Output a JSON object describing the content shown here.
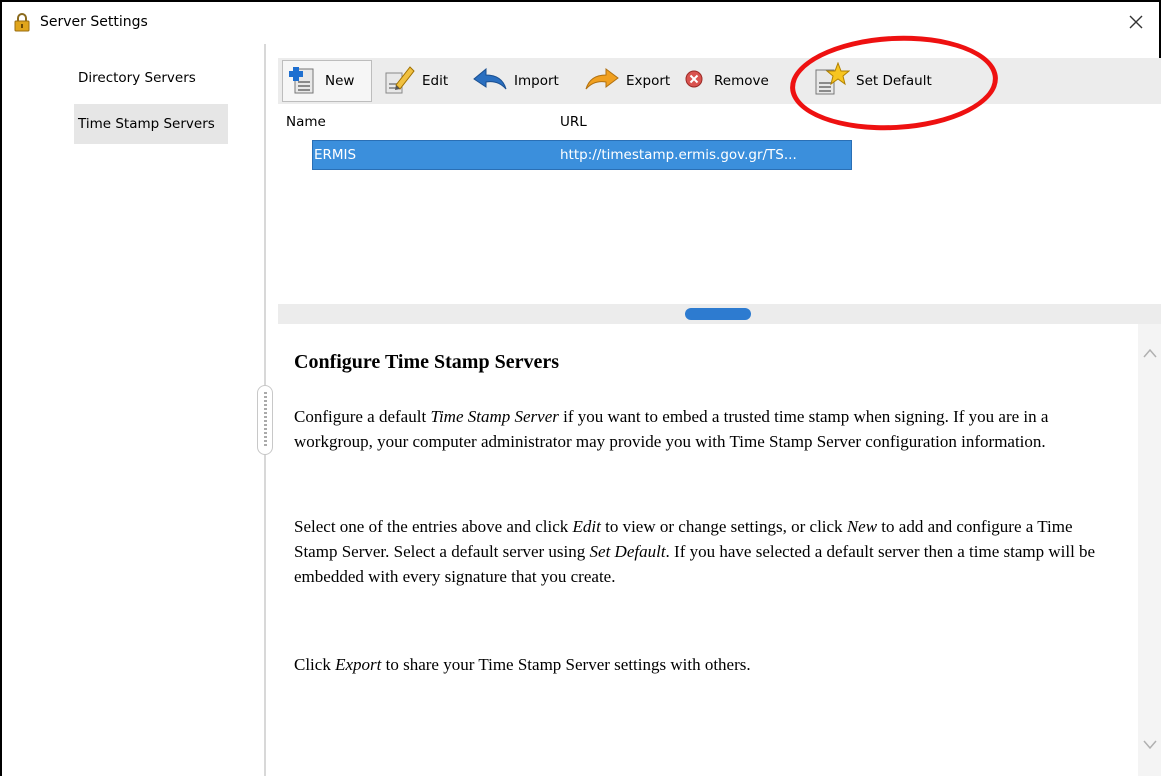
{
  "window": {
    "title": "Server Settings",
    "close_symbol": "✕"
  },
  "sidebar": {
    "items": [
      {
        "label": "Directory Servers",
        "selected": false
      },
      {
        "label": "Time Stamp Servers",
        "selected": true
      }
    ]
  },
  "toolbar": {
    "buttons": [
      {
        "label": "New",
        "icon": "new-server-icon"
      },
      {
        "label": "Edit",
        "icon": "pencil-icon"
      },
      {
        "label": "Import",
        "icon": "import-arrow-icon"
      },
      {
        "label": "Export",
        "icon": "export-arrow-icon"
      },
      {
        "label": "Remove",
        "icon": "remove-x-icon"
      },
      {
        "label": "Set Default",
        "icon": "star-server-icon"
      }
    ]
  },
  "table": {
    "columns": [
      "Name",
      "URL"
    ],
    "rows": [
      {
        "name": "ERMIS",
        "url": "http://timestamp.ermis.gov.gr/TS..."
      }
    ]
  },
  "help": {
    "heading": "Configure Time Stamp Servers",
    "p1_a": "Configure a default ",
    "p1_em": "Time Stamp Server",
    "p1_b": " if you want to embed a trusted time stamp when signing. If you are in a workgroup, your computer administrator may provide you with Time Stamp Server configuration information.",
    "p2_a": "Select one of the entries above and click ",
    "p2_em1": "Edit",
    "p2_b": " to view or change settings, or click ",
    "p2_em2": "New",
    "p2_c": " to add and configure a Time Stamp Server. Select a default server using ",
    "p2_em3": "Set Default",
    "p2_d": ". If you have selected a default server then a time stamp will be embedded with every signature that you create.",
    "p3_a": "Click ",
    "p3_em": "Export",
    "p3_b": " to share your Time Stamp Server settings with others."
  },
  "colors": {
    "selection": "#3b8fdc",
    "highlight_ring": "#e11111",
    "splitter_handle": "#2d7bd0"
  }
}
